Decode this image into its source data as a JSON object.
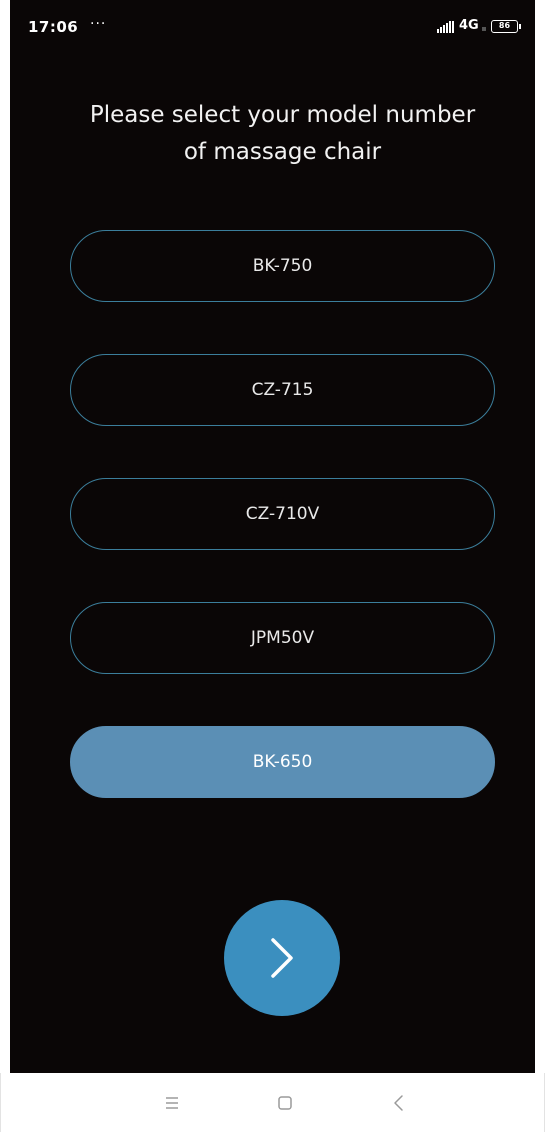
{
  "status_bar": {
    "time": "17:06",
    "dots": "···",
    "network": "4G",
    "battery": "86"
  },
  "prompt": {
    "line1": "Please select your model number",
    "line2": "of massage chair"
  },
  "models": [
    {
      "label": "BK-750",
      "selected": false
    },
    {
      "label": "CZ-715",
      "selected": false
    },
    {
      "label": "CZ-710V",
      "selected": false
    },
    {
      "label": "JPM50V",
      "selected": false
    },
    {
      "label": "BK-650",
      "selected": true
    }
  ],
  "icons": {
    "next": "chevron-right-icon",
    "nav_menu": "menu-icon",
    "nav_home": "square-home-icon",
    "nav_back": "back-chevron-icon"
  },
  "colors": {
    "background": "#0a0606",
    "option_border": "#3b7e9b",
    "selected_fill": "#5b8fb5",
    "next_button": "#3b8fbf"
  }
}
